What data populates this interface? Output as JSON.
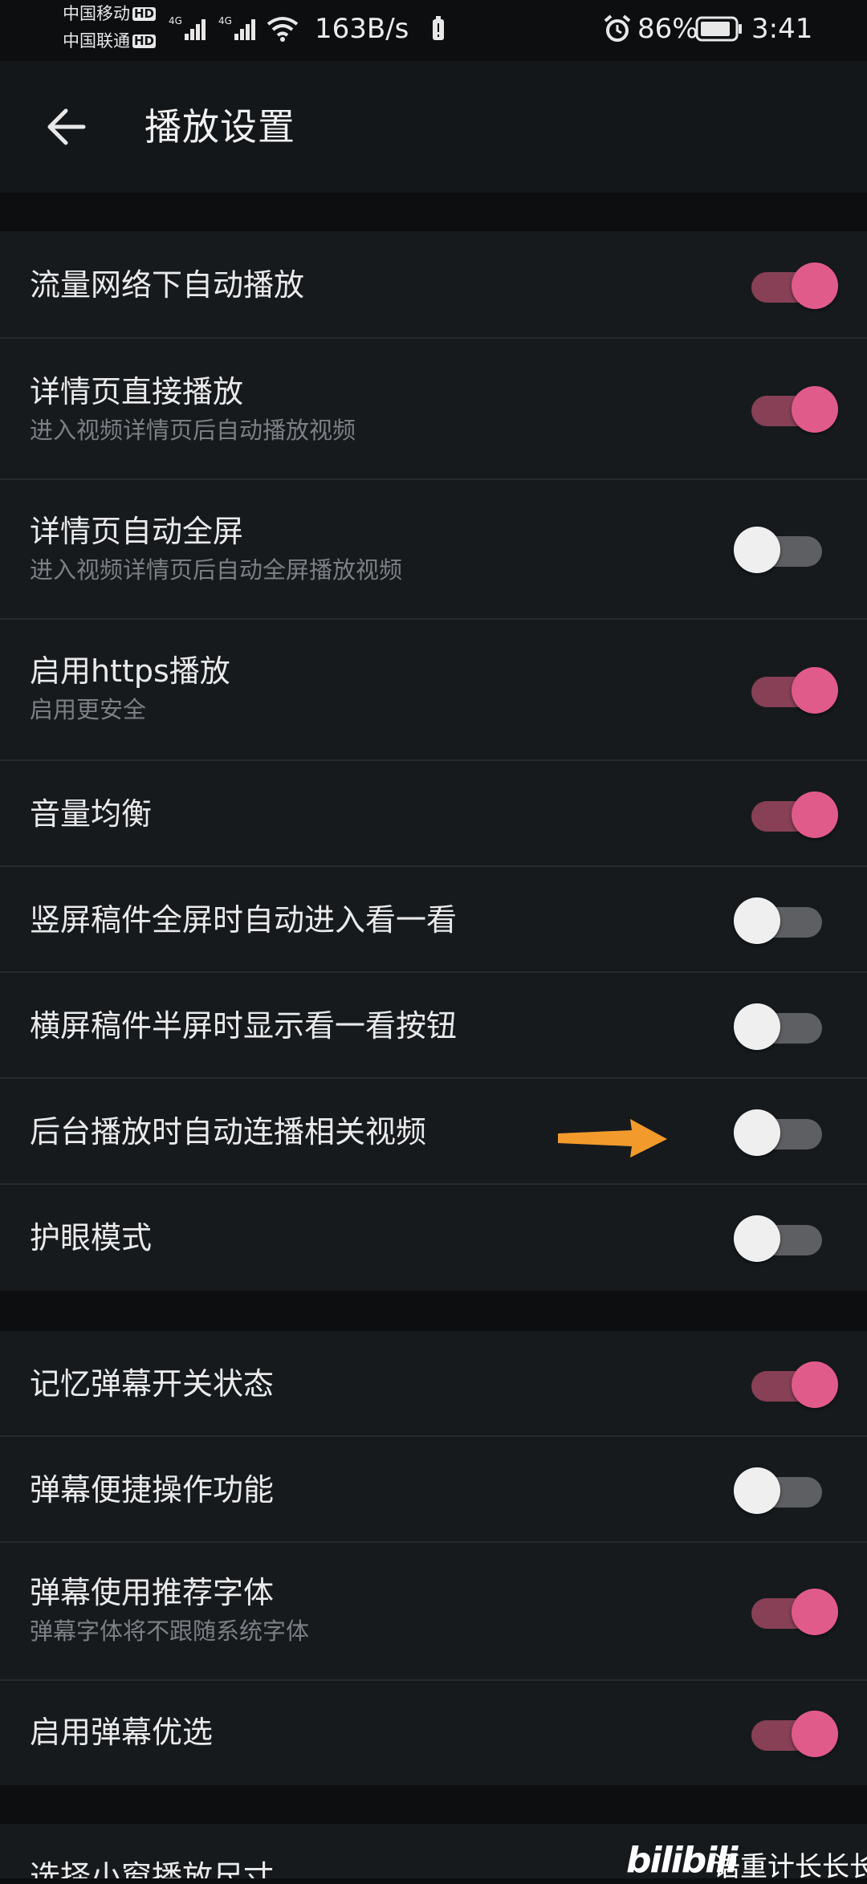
{
  "status_bar": {
    "carrier1": "中国移动",
    "carrier2": "中国联通",
    "hd": "HD",
    "net_type": "4G",
    "speed": "163B/s",
    "battery": "86%",
    "time": "3:41"
  },
  "header": {
    "title": "播放设置"
  },
  "groups": [
    {
      "items": [
        {
          "title": "流量网络下自动播放",
          "subtitle": "",
          "on": true
        },
        {
          "title": "详情页直接播放",
          "subtitle": "进入视频详情页后自动播放视频",
          "on": true
        },
        {
          "title": "详情页自动全屏",
          "subtitle": "进入视频详情页后自动全屏播放视频",
          "on": false
        },
        {
          "title": "启用https播放",
          "subtitle": "启用更安全",
          "on": true
        },
        {
          "title": "音量均衡",
          "subtitle": "",
          "on": true
        },
        {
          "title": "竖屏稿件全屏时自动进入看一看",
          "subtitle": "",
          "on": false
        },
        {
          "title": "横屏稿件半屏时显示看一看按钮",
          "subtitle": "",
          "on": false
        },
        {
          "title": "后台播放时自动连播相关视频",
          "subtitle": "",
          "on": false
        },
        {
          "title": "护眼模式",
          "subtitle": "",
          "on": false
        }
      ]
    },
    {
      "items": [
        {
          "title": "记忆弹幕开关状态",
          "subtitle": "",
          "on": true
        },
        {
          "title": "弹幕便捷操作功能",
          "subtitle": "",
          "on": false
        },
        {
          "title": "弹幕使用推荐字体",
          "subtitle": "弹幕字体将不跟随系统字体",
          "on": true
        },
        {
          "title": "启用弹幕优选",
          "subtitle": "",
          "on": true
        }
      ]
    },
    {
      "items": [
        {
          "title": "选择小窗播放尺寸",
          "subtitle": ""
        }
      ]
    }
  ],
  "watermark": {
    "logo": "bilibili",
    "author": "语重计长长长"
  },
  "colors": {
    "toggle_on_thumb": "#e05b8a",
    "toggle_on_track": "#874055",
    "toggle_off_thumb": "#efefef",
    "toggle_off_track": "#5e5f62",
    "annotation_arrow": "#f39a2c"
  }
}
